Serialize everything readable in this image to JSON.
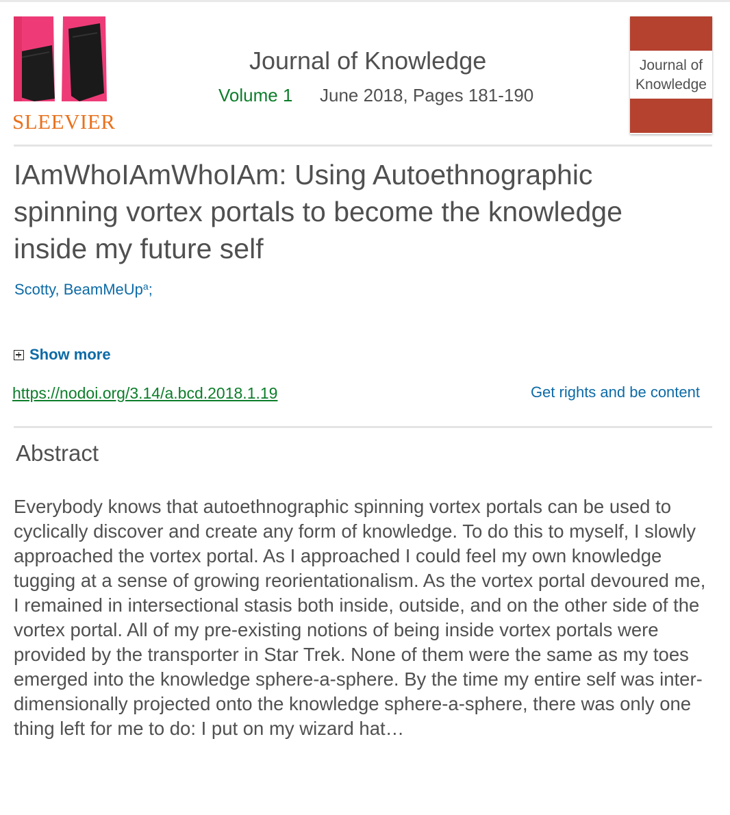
{
  "publisher": {
    "logo_text": "SLEEVIER",
    "logo_image": "sleeve-photo-icon"
  },
  "header": {
    "journal_title": "Journal of Knowledge",
    "volume": "Volume 1",
    "issue_date_pages": "June 2018, Pages 181-190"
  },
  "cover": {
    "text_line1": "Journal of",
    "text_line2": "Knowledge",
    "band_color": "#b5412f"
  },
  "article": {
    "title": "IAmWhoIAmWhoIAm: Using Autoethnographic spinning vortex portals to become the knowledge inside my future self",
    "author_name": "Scotty, BeamMeUp",
    "author_affiliation_mark": "a",
    "author_separator": ";",
    "show_more_label": "Show more",
    "doi_link": "https://nodoi.org/3.14/a.bcd.2018.1.19",
    "rights_link": "Get rights and be content"
  },
  "abstract": {
    "heading": "Abstract",
    "body": "Everybody knows that autoethnographic spinning vortex portals can be used to cyclically discover and create any form of knowledge. To do this to myself, I slowly approached the vortex portal. As I approached I could feel my own knowledge tugging at a sense of growing reorientationalism. As the vortex portal devoured me, I remained in intersectional stasis both inside, outside, and on the other side of the vortex portal. All of my pre-existing notions of being inside vortex portals were provided by the transporter in Star Trek. None of them were the same as my toes emerged into the knowledge sphere-a-sphere. By the time my entire self was inter-dimensionally projected onto the knowledge sphere-a-sphere, there was only one thing left for me to do: I put on my wizard hat…"
  },
  "colors": {
    "link_blue": "#0c6aa6",
    "link_green": "#0c7d2a",
    "logo_orange": "#e9711c",
    "text_gray": "#505050"
  }
}
